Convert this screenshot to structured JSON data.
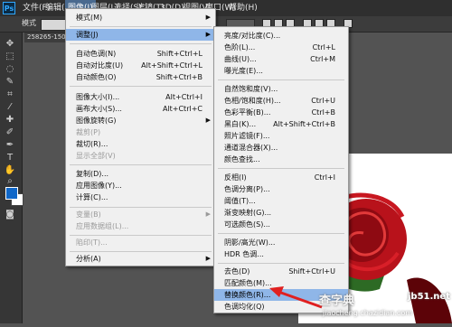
{
  "menubar": {
    "logo": "Ps",
    "items": [
      "文件(F)",
      "编辑(E)",
      "图像(I)",
      "图层(L)",
      "选择(S)",
      "滤镜(T)",
      "3D(D)",
      "视图(V)",
      "窗口(W)",
      "帮助(H)"
    ]
  },
  "options": {
    "mode_label": "模式"
  },
  "document_tab": "258265-1507",
  "image_menu": {
    "items": [
      {
        "label": "模式(M)",
        "shortcut": "",
        "submenu": true
      },
      {
        "label": "调整(J)",
        "shortcut": "",
        "submenu": true
      },
      {
        "label": "自动色调(N)",
        "shortcut": "Shift+Ctrl+L"
      },
      {
        "label": "自动对比度(U)",
        "shortcut": "Alt+Shift+Ctrl+L"
      },
      {
        "label": "自动颜色(O)",
        "shortcut": "Shift+Ctrl+B"
      },
      {
        "label": "图像大小(I)...",
        "shortcut": "Alt+Ctrl+I"
      },
      {
        "label": "画布大小(S)...",
        "shortcut": "Alt+Ctrl+C"
      },
      {
        "label": "图像旋转(G)",
        "shortcut": "",
        "submenu": true
      },
      {
        "label": "裁剪(P)",
        "shortcut": "",
        "disabled": true
      },
      {
        "label": "裁切(R)...",
        "shortcut": ""
      },
      {
        "label": "显示全部(V)",
        "shortcut": "",
        "disabled": true
      },
      {
        "label": "复制(D)...",
        "shortcut": ""
      },
      {
        "label": "应用图像(Y)...",
        "shortcut": ""
      },
      {
        "label": "计算(C)...",
        "shortcut": ""
      },
      {
        "label": "变量(B)",
        "shortcut": "",
        "disabled": true,
        "submenu": true
      },
      {
        "label": "应用数据组(L)...",
        "shortcut": "",
        "disabled": true
      },
      {
        "label": "陷印(T)...",
        "shortcut": "",
        "disabled": true
      },
      {
        "label": "分析(A)",
        "shortcut": "",
        "submenu": true
      }
    ]
  },
  "adjust_menu": {
    "items": [
      {
        "label": "亮度/对比度(C)...",
        "shortcut": ""
      },
      {
        "label": "色阶(L)...",
        "shortcut": "Ctrl+L"
      },
      {
        "label": "曲线(U)...",
        "shortcut": "Ctrl+M"
      },
      {
        "label": "曝光度(E)...",
        "shortcut": ""
      },
      {
        "label": "自然饱和度(V)...",
        "shortcut": ""
      },
      {
        "label": "色相/饱和度(H)...",
        "shortcut": "Ctrl+U"
      },
      {
        "label": "色彩平衡(B)...",
        "shortcut": "Ctrl+B"
      },
      {
        "label": "黑白(K)...",
        "shortcut": "Alt+Shift+Ctrl+B"
      },
      {
        "label": "照片滤镜(F)...",
        "shortcut": ""
      },
      {
        "label": "通道混合器(X)...",
        "shortcut": ""
      },
      {
        "label": "颜色查找...",
        "shortcut": ""
      },
      {
        "label": "反相(I)",
        "shortcut": "Ctrl+I"
      },
      {
        "label": "色调分离(P)...",
        "shortcut": ""
      },
      {
        "label": "阈值(T)...",
        "shortcut": ""
      },
      {
        "label": "渐变映射(G)...",
        "shortcut": ""
      },
      {
        "label": "可选颜色(S)...",
        "shortcut": ""
      },
      {
        "label": "阴影/高光(W)...",
        "shortcut": ""
      },
      {
        "label": "HDR 色调...",
        "shortcut": ""
      },
      {
        "label": "去色(D)",
        "shortcut": "Shift+Ctrl+U"
      },
      {
        "label": "匹配颜色(M)...",
        "shortcut": ""
      },
      {
        "label": "替换颜色(R)...",
        "shortcut": ""
      },
      {
        "label": "色调均化(Q)",
        "shortcut": ""
      }
    ]
  },
  "watermark": {
    "line1": "查字典",
    "line2": "jb51.net",
    "line3": "jiaocheng.chazidian.com"
  },
  "colors": {
    "highlight": "#8fb6e8",
    "arrow": "#e02020",
    "foreground_swatch": "#1067c8"
  }
}
